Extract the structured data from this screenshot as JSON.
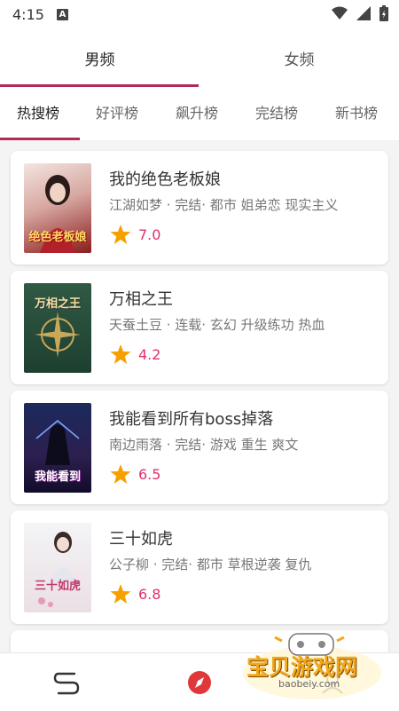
{
  "status": {
    "time": "4:15",
    "notification_letter": "A"
  },
  "gender_tabs": [
    {
      "label": "男频",
      "active": true
    },
    {
      "label": "女频",
      "active": false
    }
  ],
  "rank_tabs": [
    {
      "label": "热搜榜",
      "active": true
    },
    {
      "label": "好评榜",
      "active": false
    },
    {
      "label": "飙升榜",
      "active": false
    },
    {
      "label": "完结榜",
      "active": false
    },
    {
      "label": "新书榜",
      "active": false
    }
  ],
  "books": [
    {
      "title": "我的绝色老板娘",
      "meta": "江湖如梦 · 完结· 都市 姐弟恋 现实主义",
      "rating": "7.0",
      "cover_text": "绝色老板娘"
    },
    {
      "title": "万相之王",
      "meta": "天蚕土豆 · 连载· 玄幻 升级练功 热血",
      "rating": "4.2",
      "cover_text": "万相之王"
    },
    {
      "title": "我能看到所有boss掉落",
      "meta": "南边雨落 · 完结· 游戏 重生 爽文",
      "rating": "6.5",
      "cover_text": "我能看到"
    },
    {
      "title": "三十如虎",
      "meta": "公子柳 · 完结· 都市 草根逆袭 复仇",
      "rating": "6.8",
      "cover_text": "三十如虎"
    }
  ],
  "watermark": {
    "title": "宝贝游戏网",
    "url": "baobeiy.com"
  },
  "colors": {
    "accent": "#b0295b",
    "rating": "#e0306a",
    "star": "#f5a000"
  }
}
